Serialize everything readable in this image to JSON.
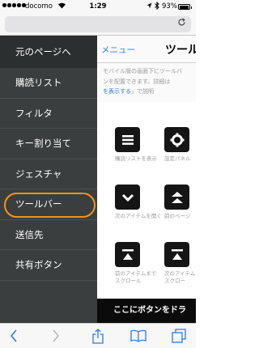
{
  "status_bar": {
    "carrier": "docomo",
    "time": "1:29",
    "battery_percent": "93%",
    "battery_level": 0.93
  },
  "browser": {
    "url_text": ""
  },
  "sidebar": {
    "header": "元のページへ",
    "items": [
      {
        "label": "購読リスト"
      },
      {
        "label": "フィルタ"
      },
      {
        "label": "キー割り当て"
      },
      {
        "label": "ジェスチャ"
      },
      {
        "label": "ツールバー",
        "highlighted": true
      },
      {
        "label": "送信先"
      },
      {
        "label": "共有ボタン"
      }
    ],
    "highlight_color": "#f39519"
  },
  "main": {
    "nav": {
      "menu_label": "メニュー",
      "title": "ツール"
    },
    "description": {
      "line1": "モバイル版の画面下にツールバ",
      "line2": "ンを配置できます。詳細は",
      "link": "を表示する",
      "line3_tail": "」で説明"
    },
    "buttons": [
      {
        "label": "購読リストを表示",
        "icon": "list-icon"
      },
      {
        "label": "設定パネル",
        "icon": "gear-icon"
      },
      {
        "label": "次のアイテムを開く",
        "icon": "chevron-down-icon"
      },
      {
        "label": "前のページ",
        "icon": "double-chevron-up-icon"
      },
      {
        "label": "前のアイテムまで",
        "label2": "スクロール",
        "icon": "scroll-to-top-icon"
      },
      {
        "label": "次のアイテム",
        "label2": "スクロー",
        "icon": "scroll-to-top-icon"
      }
    ],
    "drop_bar": "ここにボタンをドラ"
  },
  "colors": {
    "sidebar_bg": "#3b3e3e",
    "accent_blue": "#2c7ae8",
    "toolbar_blue": "#2c7ae8"
  }
}
